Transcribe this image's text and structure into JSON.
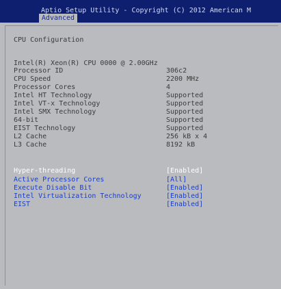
{
  "header": {
    "title": "Aptio Setup Utility - Copyright (C) 2012 American M",
    "active_tab": "Advanced"
  },
  "section": {
    "title": "CPU Configuration"
  },
  "cpu_model": "Intel(R) Xeon(R) CPU 0000 @ 2.00GHz",
  "info": [
    {
      "label": "Processor ID",
      "value": "306c2"
    },
    {
      "label": "CPU Speed",
      "value": "2200 MHz"
    },
    {
      "label": "Processor Cores",
      "value": "4"
    },
    {
      "label": "Intel HT Technology",
      "value": "Supported"
    },
    {
      "label": "Intel VT-x Technology",
      "value": "Supported"
    },
    {
      "label": "Intel SMX Technology",
      "value": "Supported"
    },
    {
      "label": "64-bit",
      "value": "Supported"
    },
    {
      "label": "EIST Technology",
      "value": "Supported"
    },
    {
      "label": "L2 Cache",
      "value": "256 kB x 4"
    },
    {
      "label": "L3 Cache",
      "value": "8192 kB"
    }
  ],
  "options": [
    {
      "label": "Hyper-threading",
      "value": "[Enabled]",
      "selected": true
    },
    {
      "label": "Active Processor Cores",
      "value": "[All]",
      "selected": false
    },
    {
      "label": "Execute Disable Bit",
      "value": "[Enabled]",
      "selected": false
    },
    {
      "label": "Intel Virtualization Technology",
      "value": "[Enabled]",
      "selected": false
    },
    {
      "label": "EIST",
      "value": "[Enabled]",
      "selected": false
    }
  ],
  "colors": {
    "header_bg": "#0d1f6e",
    "panel_bg": "#b9bbbf",
    "info_text": "#3a3a3a",
    "option_text": "#1a3fc9",
    "selected_text": "#ffffff"
  }
}
